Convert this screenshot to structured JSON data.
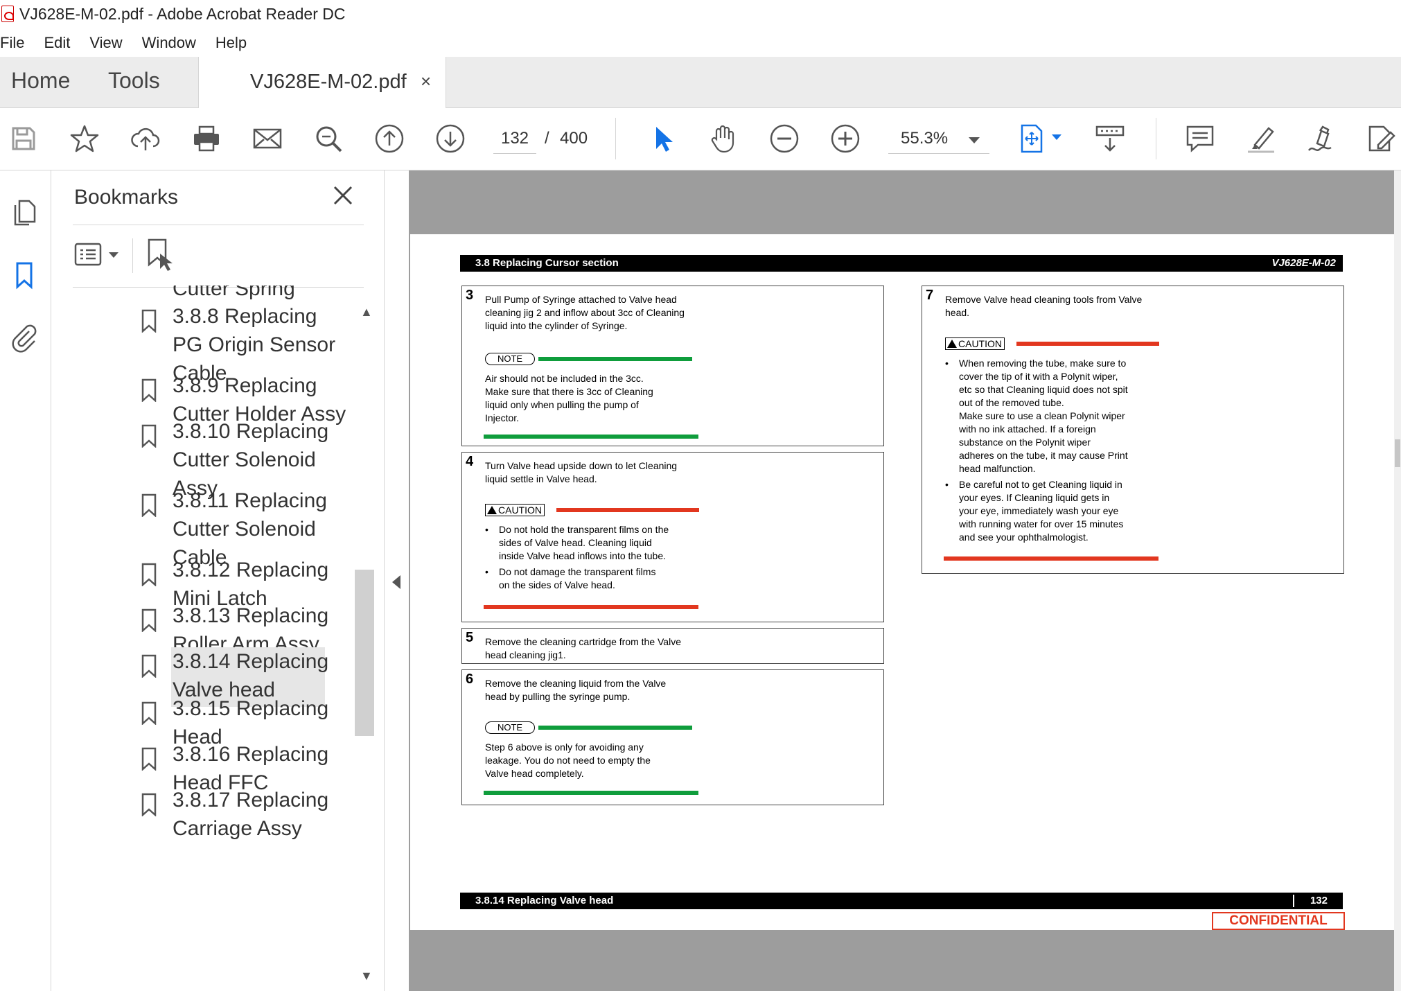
{
  "window": {
    "title": "VJ628E-M-02.pdf - Adobe Acrobat Reader DC"
  },
  "menu": {
    "items": [
      "File",
      "Edit",
      "View",
      "Window",
      "Help"
    ]
  },
  "tabs": {
    "home": "Home",
    "tools": "Tools",
    "doc": "VJ628E-M-02.pdf",
    "close": "×"
  },
  "toolbar": {
    "page_current": "132",
    "page_sep": "/",
    "page_total": "400",
    "zoom": "55.3%"
  },
  "bookmarks": {
    "title": "Bookmarks",
    "items": [
      {
        "label": "Cutter Spring"
      },
      {
        "label": "3.8.8 Replacing PG Origin Sensor Cable"
      },
      {
        "label": "3.8.9 Replacing Cutter Holder Assy"
      },
      {
        "label": "3.8.10 Replacing Cutter Solenoid Assy"
      },
      {
        "label": "3.8.11 Replacing Cutter Solenoid Cable"
      },
      {
        "label": "3.8.12 Replacing Mini Latch"
      },
      {
        "label": "3.8.13 Replacing Roller Arm Assy"
      },
      {
        "label": "3.8.14 Replacing Valve head"
      },
      {
        "label": "3.8.15 Replacing Head"
      },
      {
        "label": "3.8.16 Replacing Head FFC"
      },
      {
        "label": "3.8.17 Replacing Carriage Assy"
      }
    ],
    "selected_label": "3.8.14 Replacing Valve head"
  },
  "document": {
    "header_left": "3.8 Replacing Cursor section",
    "header_right": "VJ628E-M-02",
    "footer_left": "3.8.14 Replacing Valve head",
    "footer_page": "132",
    "confidential": "CONFIDENTIAL",
    "note_label": "NOTE",
    "caution_label": "CAUTION",
    "steps": {
      "s3": {
        "num": "3",
        "lines": [
          "Pull Pump of Syringe attached to Valve head",
          "cleaning jig 2 and inflow about 3cc of Cleaning",
          "liquid into the cylinder of Syringe."
        ],
        "note_lines": [
          "Air should not be included in the 3cc.",
          "Make sure that there is 3cc of Cleaning",
          "liquid only when pulling the pump of",
          "Injector."
        ]
      },
      "s4": {
        "num": "4",
        "lines": [
          "Turn Valve head upside down to let Cleaning",
          "liquid settle in Valve head."
        ],
        "bullets": [
          [
            "Do not hold the transparent films on the",
            "sides of Valve head. Cleaning liquid",
            "inside Valve head inflows into the tube."
          ],
          [
            "Do not damage the transparent films",
            "on the sides of Valve head."
          ]
        ]
      },
      "s5": {
        "num": "5",
        "lines": [
          "Remove the cleaning cartridge from the Valve",
          "head cleaning jig1."
        ]
      },
      "s6": {
        "num": "6",
        "lines": [
          "Remove the cleaning liquid from the Valve",
          "head by pulling the syringe pump."
        ],
        "note_lines": [
          "Step 6 above is only for avoiding any",
          "leakage. You do not need to empty the",
          "Valve head completely."
        ]
      },
      "s7": {
        "num": "7",
        "lines": [
          "Remove Valve head cleaning tools from Valve",
          "head."
        ],
        "bullets": [
          [
            "When removing the tube, make sure to",
            "cover the tip of it with a Polynit wiper,",
            "etc so that Cleaning liquid does not spit",
            "out of the removed tube.",
            "Make sure to use a clean Polynit wiper",
            "with no ink attached. If a foreign",
            "substance on the Polynit wiper",
            "adheres on the tube, it may cause Print",
            "head malfunction."
          ],
          [
            "Be careful not to get Cleaning liquid in",
            "your eyes. If Cleaning liquid gets in",
            "your eye, immediately wash your eye",
            "with running water for over 15 minutes",
            "and see your ophthalmologist."
          ]
        ]
      }
    }
  },
  "colors": {
    "note_green": "#0f9d3c",
    "caution_red": "#e2371f",
    "acrobat_blue": "#1473e6"
  }
}
